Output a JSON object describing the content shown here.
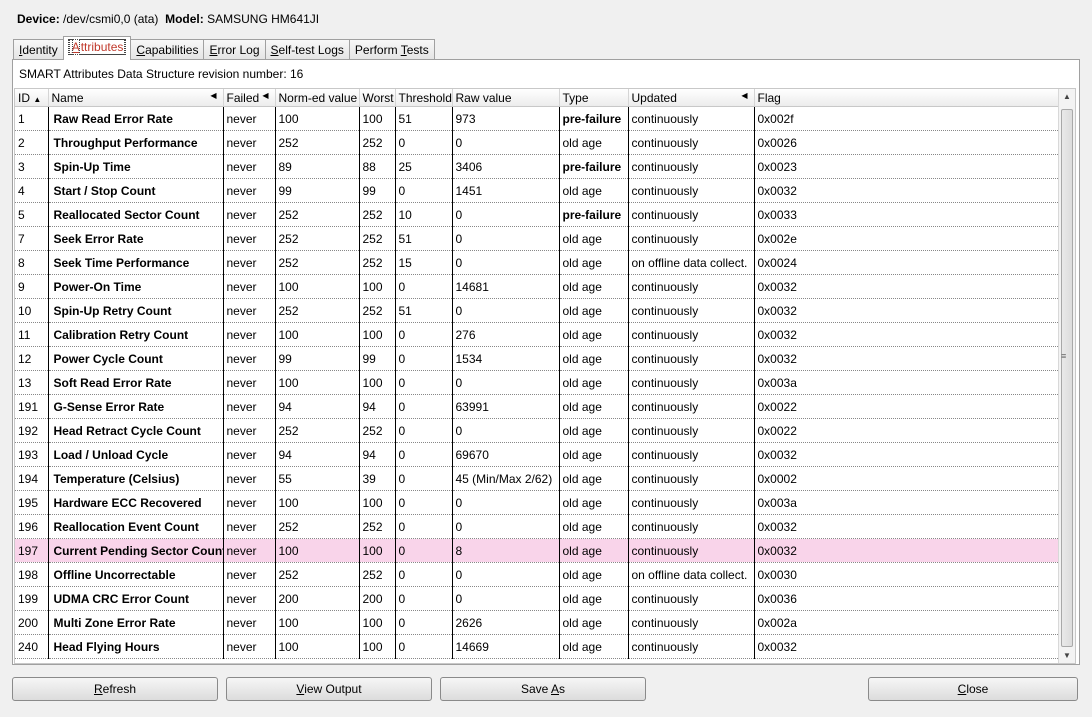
{
  "device": {
    "device_label": "Device:",
    "device_value": "/dev/csmi0,0 (ata)",
    "model_label": "Model:",
    "model_value": "SAMSUNG HM641JI"
  },
  "tabs": [
    {
      "pre": "",
      "key": "I",
      "post": "dentity"
    },
    {
      "pre": "",
      "key": "A",
      "post": "ttributes"
    },
    {
      "pre": "",
      "key": "C",
      "post": "apabilities"
    },
    {
      "pre": "",
      "key": "E",
      "post": "rror Log"
    },
    {
      "pre": "",
      "key": "S",
      "post": "elf-test Logs"
    },
    {
      "pre": "Perform ",
      "key": "T",
      "post": "ests"
    }
  ],
  "revision_text": "SMART Attributes Data Structure revision number: 16",
  "columns": [
    "ID",
    "Name",
    "Failed",
    "Norm-ed value",
    "Worst",
    "Threshold",
    "Raw value",
    "Type",
    "Updated",
    "Flag"
  ],
  "rows": [
    [
      "1",
      "Raw Read Error Rate",
      "never",
      "100",
      "100",
      "51",
      "973",
      "pre-failure",
      "continuously",
      "0x002f"
    ],
    [
      "2",
      "Throughput Performance",
      "never",
      "252",
      "252",
      "0",
      "0",
      "old age",
      "continuously",
      "0x0026"
    ],
    [
      "3",
      "Spin-Up Time",
      "never",
      "89",
      "88",
      "25",
      "3406",
      "pre-failure",
      "continuously",
      "0x0023"
    ],
    [
      "4",
      "Start / Stop Count",
      "never",
      "99",
      "99",
      "0",
      "1451",
      "old age",
      "continuously",
      "0x0032"
    ],
    [
      "5",
      "Reallocated Sector Count",
      "never",
      "252",
      "252",
      "10",
      "0",
      "pre-failure",
      "continuously",
      "0x0033"
    ],
    [
      "7",
      "Seek Error Rate",
      "never",
      "252",
      "252",
      "51",
      "0",
      "old age",
      "continuously",
      "0x002e"
    ],
    [
      "8",
      "Seek Time Performance",
      "never",
      "252",
      "252",
      "15",
      "0",
      "old age",
      "on offline data collect.",
      "0x0024"
    ],
    [
      "9",
      "Power-On Time",
      "never",
      "100",
      "100",
      "0",
      "14681",
      "old age",
      "continuously",
      "0x0032"
    ],
    [
      "10",
      "Spin-Up Retry Count",
      "never",
      "252",
      "252",
      "51",
      "0",
      "old age",
      "continuously",
      "0x0032"
    ],
    [
      "11",
      "Calibration Retry Count",
      "never",
      "100",
      "100",
      "0",
      "276",
      "old age",
      "continuously",
      "0x0032"
    ],
    [
      "12",
      "Power Cycle Count",
      "never",
      "99",
      "99",
      "0",
      "1534",
      "old age",
      "continuously",
      "0x0032"
    ],
    [
      "13",
      "Soft Read Error Rate",
      "never",
      "100",
      "100",
      "0",
      "0",
      "old age",
      "continuously",
      "0x003a"
    ],
    [
      "191",
      "G-Sense Error Rate",
      "never",
      "94",
      "94",
      "0",
      "63991",
      "old age",
      "continuously",
      "0x0022"
    ],
    [
      "192",
      "Head Retract Cycle Count",
      "never",
      "252",
      "252",
      "0",
      "0",
      "old age",
      "continuously",
      "0x0022"
    ],
    [
      "193",
      "Load / Unload Cycle",
      "never",
      "94",
      "94",
      "0",
      "69670",
      "old age",
      "continuously",
      "0x0032"
    ],
    [
      "194",
      "Temperature (Celsius)",
      "never",
      "55",
      "39",
      "0",
      "45 (Min/Max 2/62)",
      "old age",
      "continuously",
      "0x0002"
    ],
    [
      "195",
      "Hardware ECC Recovered",
      "never",
      "100",
      "100",
      "0",
      "0",
      "old age",
      "continuously",
      "0x003a"
    ],
    [
      "196",
      "Reallocation Event Count",
      "never",
      "252",
      "252",
      "0",
      "0",
      "old age",
      "continuously",
      "0x0032"
    ],
    [
      "197",
      "Current Pending Sector Count",
      "never",
      "100",
      "100",
      "0",
      "8",
      "old age",
      "continuously",
      "0x0032"
    ],
    [
      "198",
      "Offline Uncorrectable",
      "never",
      "252",
      "252",
      "0",
      "0",
      "old age",
      "on offline data collect.",
      "0x0030"
    ],
    [
      "199",
      "UDMA CRC Error Count",
      "never",
      "200",
      "200",
      "0",
      "0",
      "old age",
      "continuously",
      "0x0036"
    ],
    [
      "200",
      "Multi Zone Error Rate",
      "never",
      "100",
      "100",
      "0",
      "2626",
      "old age",
      "continuously",
      "0x002a"
    ],
    [
      "240",
      "Head Flying Hours",
      "never",
      "100",
      "100",
      "0",
      "14669",
      "old age",
      "continuously",
      "0x0032"
    ]
  ],
  "highlight_id": "197",
  "highlight_color": "#f9d4ea",
  "buttons": {
    "refresh": {
      "pre": "",
      "key": "R",
      "post": "efresh"
    },
    "view_output": {
      "pre": "",
      "key": "V",
      "post": "iew Output"
    },
    "save_as": {
      "pre": "Save ",
      "key": "A",
      "post": "s"
    },
    "close": {
      "pre": "",
      "key": "C",
      "post": "lose"
    }
  }
}
